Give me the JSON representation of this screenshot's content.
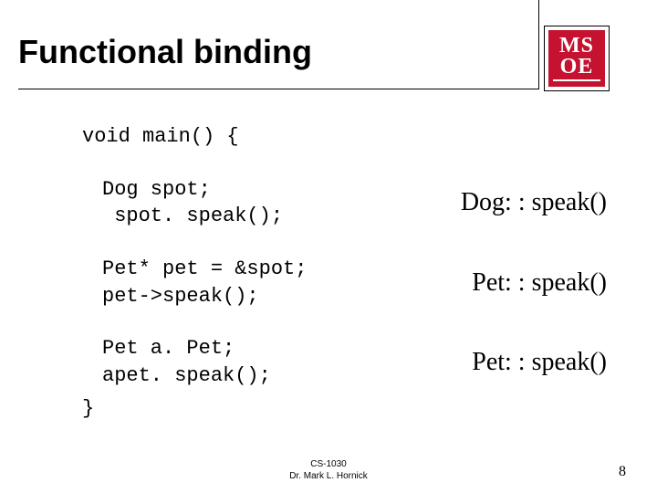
{
  "title": "Functional binding",
  "logo": {
    "line1": "MS",
    "line2": "OE"
  },
  "code": {
    "sig": "void main() {",
    "b1l1": "Dog spot;",
    "b1l2": " spot. speak();",
    "b2l1": "Pet* pet = &spot;",
    "b2l2": "pet->speak();",
    "b3l1": "Pet a. Pet;",
    "b3l2": "apet. speak();",
    "close": "}"
  },
  "annotations": {
    "a1": "Dog: : speak()",
    "a2": "Pet: : speak()",
    "a3": "Pet: : speak()"
  },
  "footer": {
    "course": "CS-1030",
    "author": "Dr. Mark L. Hornick"
  },
  "page": "8"
}
